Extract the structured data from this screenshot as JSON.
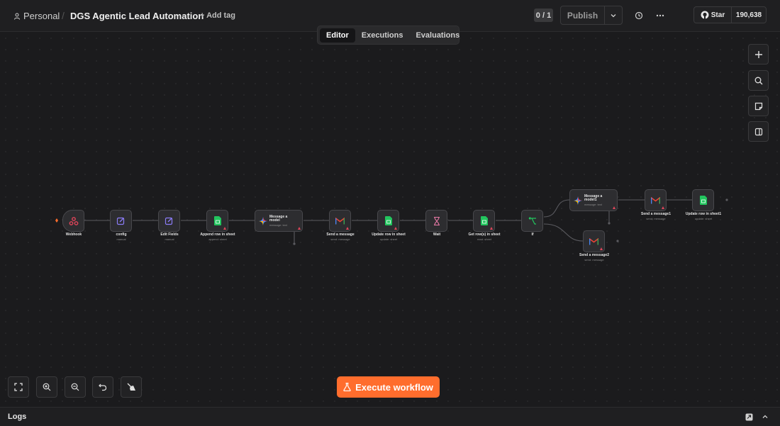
{
  "header": {
    "project": "Personal",
    "workflow_name": "DGS Agentic Lead Automation",
    "add_tag": "+ Add tag",
    "counter": "0 / 1",
    "publish": "Publish",
    "github_star": "Star",
    "github_count": "190,638"
  },
  "tabs": [
    {
      "label": "Editor",
      "active": true
    },
    {
      "label": "Executions",
      "active": false
    },
    {
      "label": "Evaluations",
      "active": false
    }
  ],
  "execute_button": "Execute workflow",
  "logs": {
    "label": "Logs"
  },
  "nodes": {
    "webhook": {
      "title": "Webhook",
      "sub": ""
    },
    "config": {
      "title": "config",
      "sub": "manual"
    },
    "edit_fields": {
      "title": "Edit Fields",
      "sub": "manual"
    },
    "append_row": {
      "title": "Append row in sheet",
      "sub": "append: sheet"
    },
    "message_model": {
      "title": "Message a model",
      "sub": "message: text"
    },
    "send_message": {
      "title": "Send a message",
      "sub": "send: message"
    },
    "update_row": {
      "title": "Update row in sheet",
      "sub": "update: sheet"
    },
    "wait": {
      "title": "Wait",
      "sub": ""
    },
    "get_rows": {
      "title": "Get row(s) in sheet",
      "sub": "read: sheet"
    },
    "if": {
      "title": "If",
      "sub": ""
    },
    "message_model1": {
      "title": "Message a model1",
      "sub": "message: text"
    },
    "send_message1": {
      "title": "Send a message1",
      "sub": "send: message"
    },
    "update_row1": {
      "title": "Update row in sheet1",
      "sub": "update: sheet"
    },
    "send_message2": {
      "title": "Send a message2",
      "sub": "send: message"
    }
  },
  "colors": {
    "accent": "#ff6d2d",
    "sheets": "#22c55e",
    "edit": "#8b7cf6",
    "warning": "#e0455a",
    "if": "#22c55e"
  }
}
